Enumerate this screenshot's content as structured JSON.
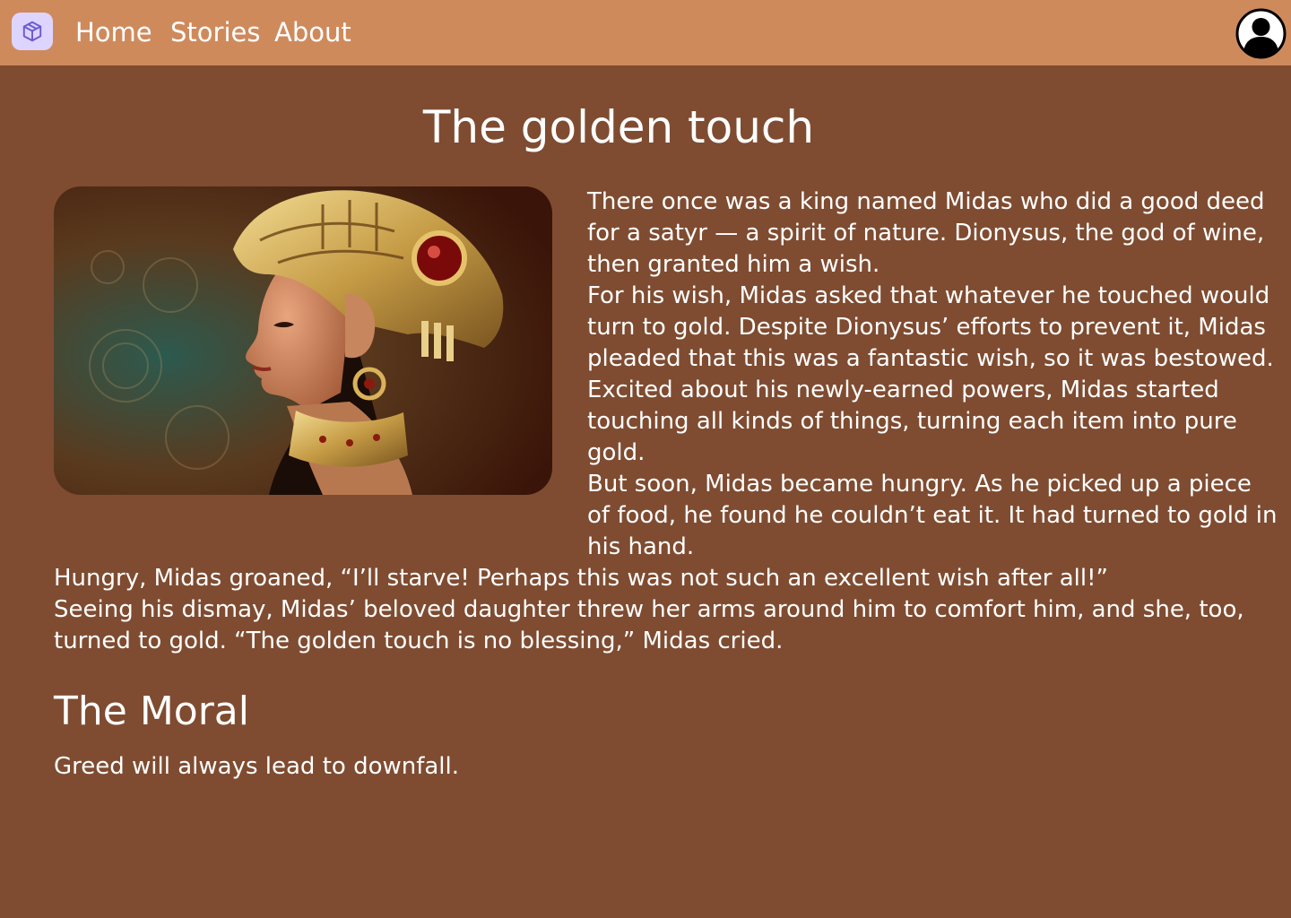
{
  "nav": {
    "logo_icon": "cube-icon",
    "links": [
      {
        "label": "Home"
      },
      {
        "label": "Stories"
      },
      {
        "label": "About"
      }
    ],
    "avatar_icon": "user-avatar-icon"
  },
  "story": {
    "title": "The golden touch",
    "image_icon": "portrait-image",
    "paragraphs": [
      "There once was a king named Midas who did a good deed for a satyr — a spirit of nature. Dionysus, the god of wine, then granted him a wish.",
      "For his wish, Midas asked that whatever he touched would turn to gold. Despite Dionysus’ efforts to prevent it, Midas pleaded that this was a fantastic wish, so it was bestowed.",
      "Excited about his newly-earned powers, Midas started touching all kinds of things, turning each item into pure gold.",
      "But soon, Midas became hungry. As he picked up a piece of food, he found he couldn’t eat it. It had turned to gold in his hand.",
      "Hungry, Midas groaned, “I’ll starve! Perhaps this was not such an excellent wish after all!”",
      "Seeing his dismay, Midas’ beloved daughter threw her arms around him to comfort him, and she, too, turned to gold. “The golden touch is no blessing,” Midas cried."
    ],
    "moral_heading": "The Moral",
    "moral_text": "Greed will always lead to downfall."
  },
  "colors": {
    "nav_background": "#cf8a5c",
    "page_background": "#7f4c31",
    "logo_background": "#ddd5ff",
    "text": "#ffffff"
  }
}
